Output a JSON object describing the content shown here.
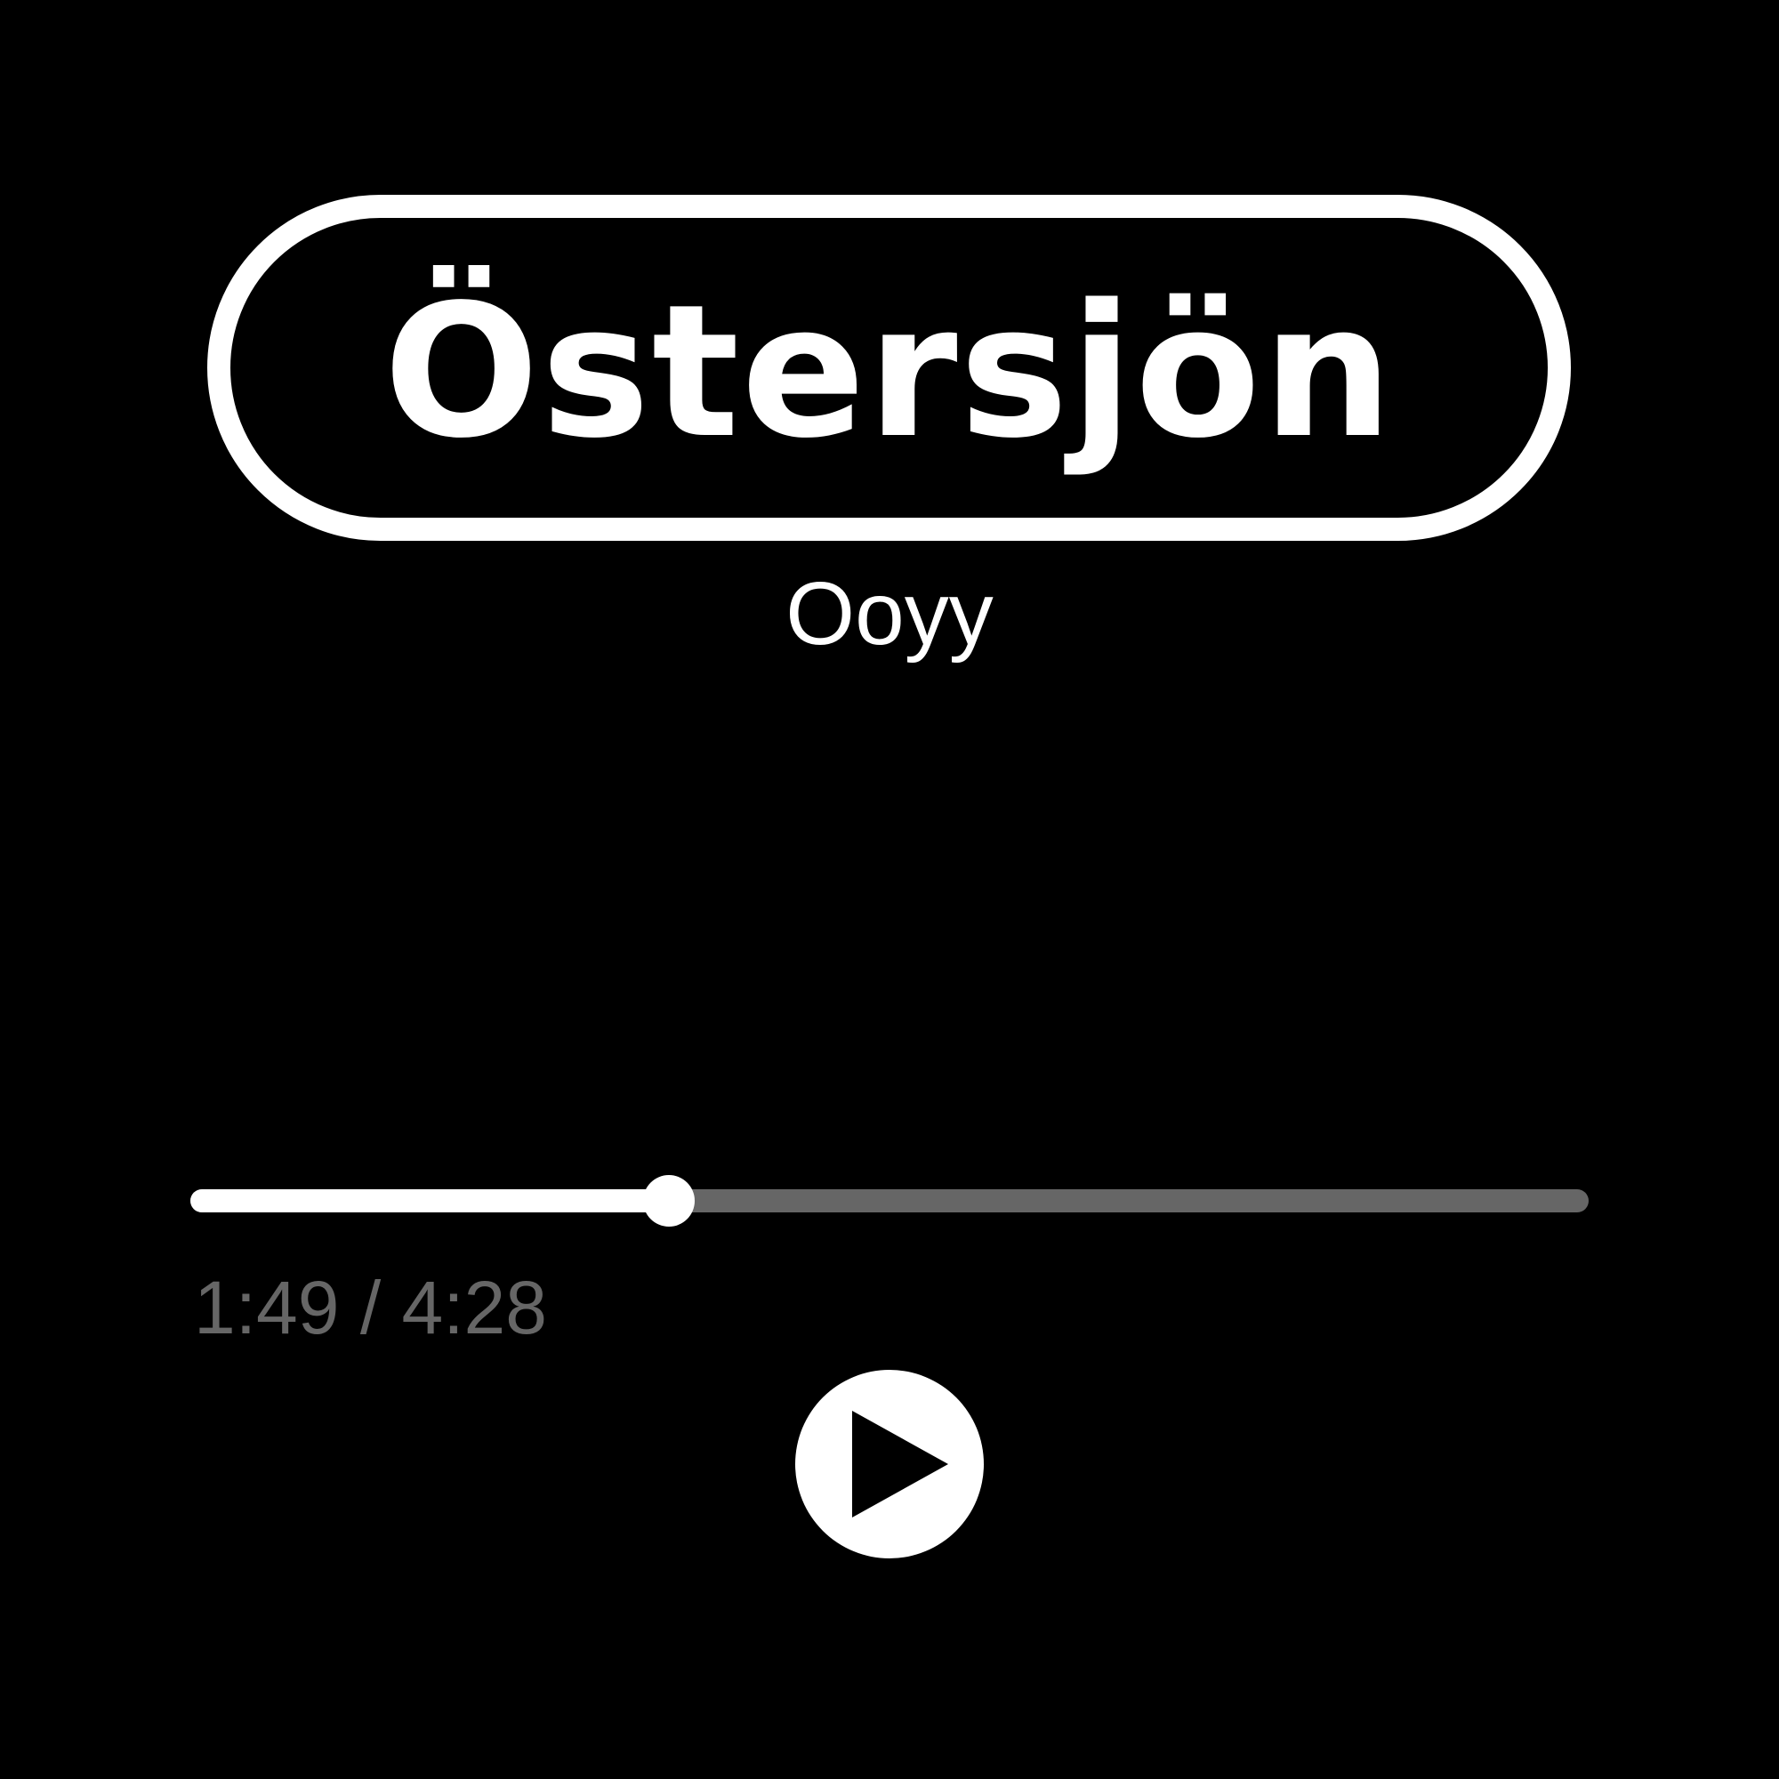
{
  "track": {
    "title": "Östersjön",
    "artist": "Ooyy"
  },
  "playback": {
    "elapsed": "1:49",
    "duration": "4:28",
    "time_display": "1:49 / 4:28",
    "progress_fraction": 0.342
  },
  "controls": {
    "play_icon": "play-icon"
  },
  "colors": {
    "background": "#000000",
    "foreground": "#ffffff",
    "muted": "#666666"
  }
}
